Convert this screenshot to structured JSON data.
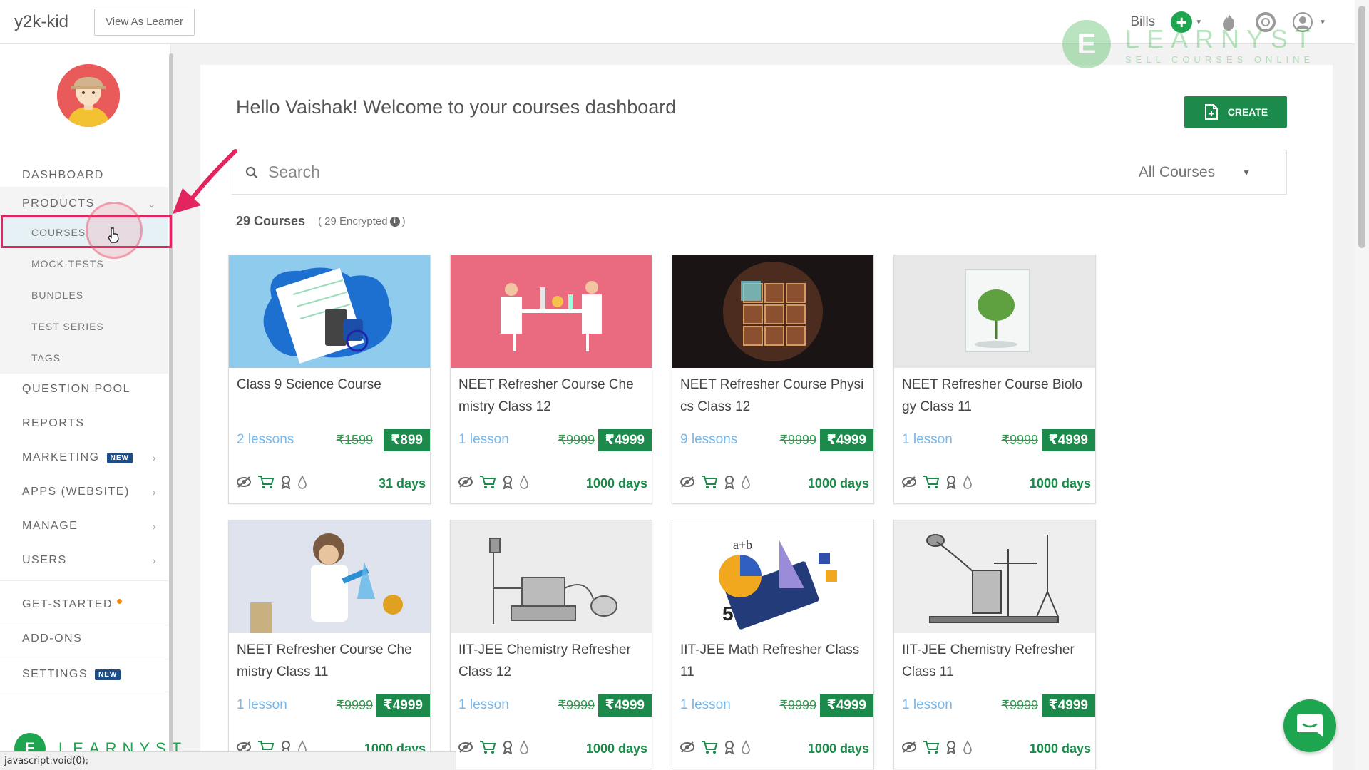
{
  "topbar": {
    "brand": "y2k-kid",
    "view_as_learner": "View As Learner",
    "bills": "Bills"
  },
  "watermark": {
    "title": "LEARNYST",
    "subtitle": "SELL COURSES ONLINE"
  },
  "sidebar": {
    "dashboard": "DASHBOARD",
    "products": "PRODUCTS",
    "products_sub": [
      "COURSES",
      "MOCK-TESTS",
      "BUNDLES",
      "TEST SERIES",
      "TAGS"
    ],
    "question_pool": "QUESTION POOL",
    "reports": "REPORTS",
    "marketing": "MARKETING",
    "apps": "APPS (WEBSITE)",
    "manage": "MANAGE",
    "users": "USERS",
    "get_started": "GET-STARTED",
    "add_ons": "ADD-ONS",
    "settings": "SETTINGS",
    "new_badge": "NEW",
    "bottom_logo": "LEARNYST"
  },
  "main": {
    "welcome": "Hello Vaishak! Welcome to your courses dashboard",
    "create_label": "CREATE",
    "search_placeholder": "Search",
    "filter_selected": "All Courses",
    "course_count": "29 Courses",
    "encrypted": "( 29 Encrypted",
    "encrypted_close": ")"
  },
  "courses": [
    {
      "title": "Class 9 Science Course",
      "lessons": "2 lessons",
      "old_price": "₹1599",
      "price": "₹899",
      "validity": "31 days"
    },
    {
      "title": "NEET Refresher Course Che mistry Class 12",
      "lessons": "1 lesson",
      "old_price": "₹9999",
      "price": "₹4999",
      "validity": "1000 days"
    },
    {
      "title": "NEET Refresher Course Physi cs Class 12",
      "lessons": "9 lessons",
      "old_price": "₹9999",
      "price": "₹4999",
      "validity": "1000 days"
    },
    {
      "title": "NEET Refresher Course Biolo gy Class 11",
      "lessons": "1 lesson",
      "old_price": "₹9999",
      "price": "₹4999",
      "validity": "1000 days"
    },
    {
      "title": "NEET Refresher Course Che mistry Class 11",
      "lessons": "1 lesson",
      "old_price": "₹9999",
      "price": "₹4999",
      "validity": "1000 days"
    },
    {
      "title": "IIT-JEE Chemistry Refresher Class 12",
      "lessons": "1 lesson",
      "old_price": "₹9999",
      "price": "₹4999",
      "validity": "1000 days"
    },
    {
      "title": "IIT-JEE Math Refresher Class 11",
      "lessons": "1 lesson",
      "old_price": "₹9999",
      "price": "₹4999",
      "validity": "1000 days"
    },
    {
      "title": "IIT-JEE Chemistry Refresher Class 11",
      "lessons": "1 lesson",
      "old_price": "₹9999",
      "price": "₹4999",
      "validity": "1000 days"
    }
  ],
  "statusbar": "javascript:void(0);",
  "colors": {
    "brand_green": "#1b8a4a",
    "highlight": "#e3245e",
    "lesson_blue": "#7ab6e6"
  }
}
